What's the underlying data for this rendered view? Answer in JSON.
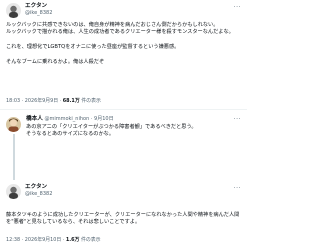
{
  "post1": {
    "display_name": "エクタン",
    "handle": "@ike_8382",
    "text_lines": [
      "ルックバックに共感できないのは、俺自身が精神を病んだおじさん側だからかもしれない。",
      "ルックバックで描かれる俺は、人生の成功者であるクリエーター様を殺すモンスターなんだよな。",
      "",
      "これを、理想化でLGBTQをオナニに使った昼座が監督するという嫌悪感。",
      "",
      "そんなブームに乗れるかよ。俺は人殺だぞ"
    ],
    "time": "18:03 · 2026年9月9日 · ",
    "views_count": "68.1万",
    "views_label": " 件の表示"
  },
  "post2": {
    "display_name": "橋本人",
    "handle": "@mimmoki_nihon · 9月10日",
    "text_lines": [
      "あの京アニの「クリエイターがぶつかる障害者観」であるべきだと思う。",
      "そうなるとあのサイズになるのかな。"
    ]
  },
  "post3": {
    "display_name": "エクタン",
    "handle": "@ike_8382",
    "text_lines": [
      "藤本タツキのように成功したクリエーターが、クリエーターになれなかった人間や精神を病んだ人間を\"悪者\"と見なしているなら、それは悲しいことですよ。"
    ],
    "time": "12:38 · 2026年9月10日 · ",
    "views_count": "1.6万",
    "views_label": " 件の表示"
  },
  "icons": {
    "more": "more-icon",
    "avatar1": "avatar-icon",
    "avatar2": "avatar-icon",
    "avatar3": "avatar-icon"
  }
}
